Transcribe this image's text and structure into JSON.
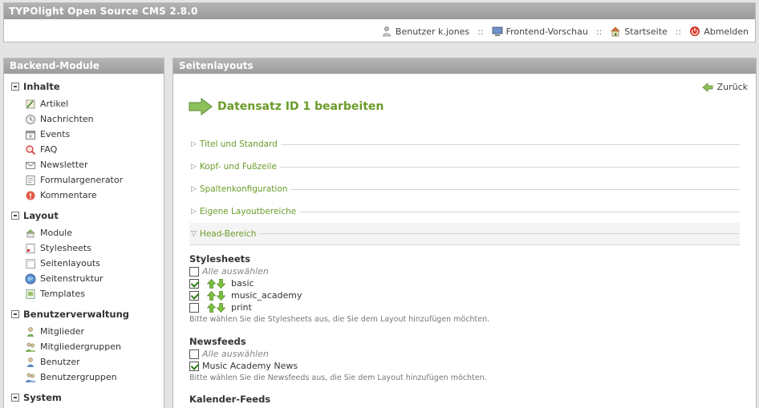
{
  "app_title": "TYPOlight Open Source CMS 2.8.0",
  "topnav": {
    "user": "Benutzer k.jones",
    "preview": "Frontend-Vorschau",
    "home": "Startseite",
    "logout": "Abmelden",
    "separator": "::"
  },
  "sidebar": {
    "title": "Backend-Module",
    "groups": [
      {
        "label": "Inhalte",
        "items": [
          {
            "label": "Artikel",
            "icon": "article-icon"
          },
          {
            "label": "Nachrichten",
            "icon": "news-icon"
          },
          {
            "label": "Events",
            "icon": "events-icon"
          },
          {
            "label": "FAQ",
            "icon": "faq-icon"
          },
          {
            "label": "Newsletter",
            "icon": "newsletter-icon"
          },
          {
            "label": "Formulargenerator",
            "icon": "form-icon"
          },
          {
            "label": "Kommentare",
            "icon": "comments-icon"
          }
        ]
      },
      {
        "label": "Layout",
        "items": [
          {
            "label": "Module",
            "icon": "modules-icon"
          },
          {
            "label": "Stylesheets",
            "icon": "stylesheets-icon"
          },
          {
            "label": "Seitenlayouts",
            "icon": "layouts-icon"
          },
          {
            "label": "Seitenstruktur",
            "icon": "globe-icon"
          },
          {
            "label": "Templates",
            "icon": "templates-icon"
          }
        ]
      },
      {
        "label": "Benutzerverwaltung",
        "items": [
          {
            "label": "Mitglieder",
            "icon": "member-icon"
          },
          {
            "label": "Mitgliedergruppen",
            "icon": "member-groups-icon"
          },
          {
            "label": "Benutzer",
            "icon": "user-icon"
          },
          {
            "label": "Benutzergruppen",
            "icon": "user-groups-icon"
          }
        ]
      },
      {
        "label": "System",
        "items": []
      }
    ]
  },
  "main": {
    "title": "Seitenlayouts",
    "back": "Zurück",
    "heading": "Datensatz ID 1 bearbeiten",
    "legends": [
      "Titel und Standard",
      "Kopf- und Fußzeile",
      "Spaltenkonfiguration",
      "Eigene Layoutbereiche",
      "Head-Bereich"
    ],
    "stylesheets": {
      "title": "Stylesheets",
      "select_all": "Alle auswählen",
      "options": [
        {
          "label": "basic",
          "checked": true
        },
        {
          "label": "music_academy",
          "checked": true
        },
        {
          "label": "print",
          "checked": false
        }
      ],
      "hint": "Bitte wählen Sie die Stylesheets aus, die Sie dem Layout hinzufügen möchten."
    },
    "newsfeeds": {
      "title": "Newsfeeds",
      "select_all": "Alle auswählen",
      "options": [
        {
          "label": "Music Academy News",
          "checked": true
        }
      ],
      "hint": "Bitte wählen Sie die Newsfeeds aus, die Sie dem Layout hinzufügen möchten."
    },
    "calendar_feeds": {
      "title": "Kalender-Feeds"
    }
  },
  "colors": {
    "accent": "#6b9c2a",
    "header_gray": "#a8a8a8",
    "background": "#e4e4e4"
  }
}
